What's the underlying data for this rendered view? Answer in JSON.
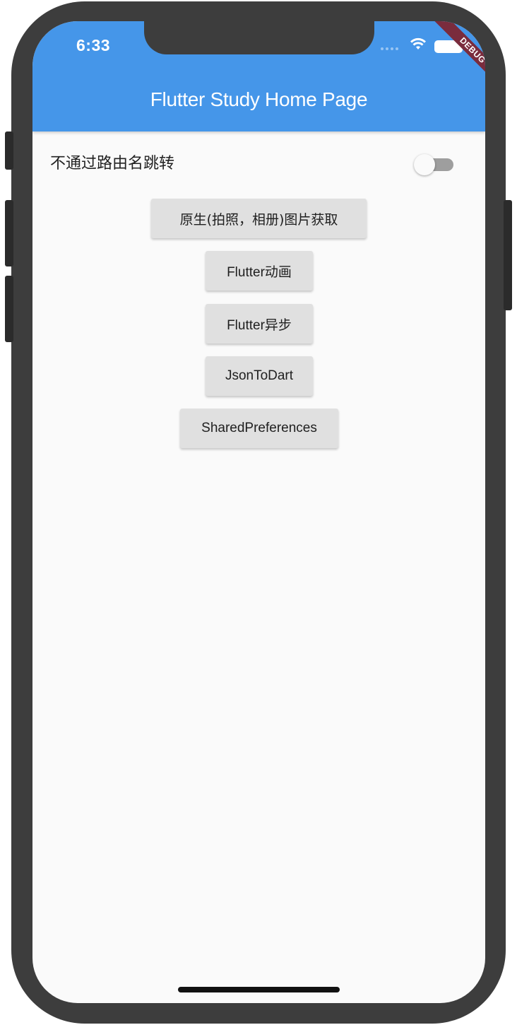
{
  "status_bar": {
    "time": "6:33"
  },
  "app_bar": {
    "title": "Flutter Study Home Page",
    "color": "#4596e9"
  },
  "debug_banner": {
    "label": "DEBUG",
    "color": "#7a2c3d"
  },
  "switch_row": {
    "label": "不通过路由名跳转",
    "switch_on": false
  },
  "buttons": [
    {
      "label": "原生(拍照，相册)图片获取"
    },
    {
      "label": "Flutter动画"
    },
    {
      "label": "Flutter异步"
    },
    {
      "label": "JsonToDart"
    },
    {
      "label": "SharedPreferences"
    }
  ],
  "icons": {
    "wifi": "wifi-icon",
    "battery": "battery-icon",
    "signal": "signal-dots-icon"
  }
}
